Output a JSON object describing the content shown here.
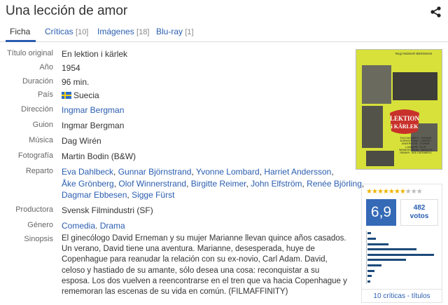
{
  "film": {
    "title": "Una lección de amor"
  },
  "tabs": [
    {
      "label": "Ficha",
      "count": ""
    },
    {
      "label": "Críticas",
      "count": "[10]"
    },
    {
      "label": "Imágenes",
      "count": "[18]"
    },
    {
      "label": "Blu-ray",
      "count": "[1]"
    }
  ],
  "details": {
    "original_title_label": "Título original",
    "original_title": "En lektion i kärlek",
    "year_label": "Año",
    "year": "1954",
    "duration_label": "Duración",
    "duration": "96 min.",
    "country_label": "País",
    "country": "Suecia",
    "director_label": "Dirección",
    "director": "Ingmar Bergman",
    "screenplay_label": "Guion",
    "screenplay": "Ingmar Bergman",
    "music_label": "Música",
    "music": "Dag Wirén",
    "photography_label": "Fotografía",
    "photography": "Martin Bodin (B&W)",
    "cast_label": "Reparto",
    "cast_line1": [
      "Eva Dahlbeck",
      "Gunnar Björnstrand",
      "Yvonne Lombard",
      "Harriet Andersson"
    ],
    "cast_line2": [
      "Åke Grönberg",
      "Olof Winnerstrand",
      "Birgitte Reimer",
      "John Elfström",
      "Renée Björling"
    ],
    "cast_line3": [
      "Dagmar Ebbesen",
      "Sigge Fürst"
    ],
    "producer_label": "Productora",
    "producer": "Svensk Filmindustri (SF)",
    "genre_label": "Género",
    "genres": [
      "Comedia",
      "Drama"
    ],
    "synopsis_label": "Sinopsis",
    "synopsis": "El ginecólogo David Erneman y su mujer Marianne llevan quince años casados. Un verano, David tiene una aventura. Marianne, desesperada, huye de Copenhague para reanudar la relación con su ex-novio, Carl Adam. David, celoso y hastiado de su amante, sólo desea una cosa: reconquistar a su esposa. Los dos vuelven a reencontrarse en el tren que va hacia Copenhague y rememoran las escenas de su vida en común. (FILMAFFINITY)"
  },
  "poster": {
    "title_line1": "LEKTION",
    "title_line2": "i KÄRLEK",
    "credits": "EVA DAHLBECK · GUNNAR BJÖRNSTRAND · HARRIET ANDERSSON · YVONNE LOMBARD · OLOF WINNERSTRAND · BIRGITTE REIMER · ÅKE GRÖNBERG",
    "top_text": "Regi INGMAR BERGMAN"
  },
  "rating": {
    "stars_filled": 7,
    "stars_total": 10,
    "average": "6,9",
    "votes_count": "482",
    "votes_label": "votos",
    "critics_link": "10 críticas - títulos",
    "histogram": [
      0.04,
      0.06,
      0.1,
      0.2,
      0.55,
      0.95,
      0.7,
      0.3,
      0.12,
      0.05
    ]
  },
  "colors": {
    "link": "#2a5db0",
    "rating_bg": "#356ab7",
    "star": "#f0b400",
    "poster_bg": "#d7e13a"
  },
  "icons": {
    "share": "share-icon",
    "flag": "sweden-flag-icon"
  }
}
